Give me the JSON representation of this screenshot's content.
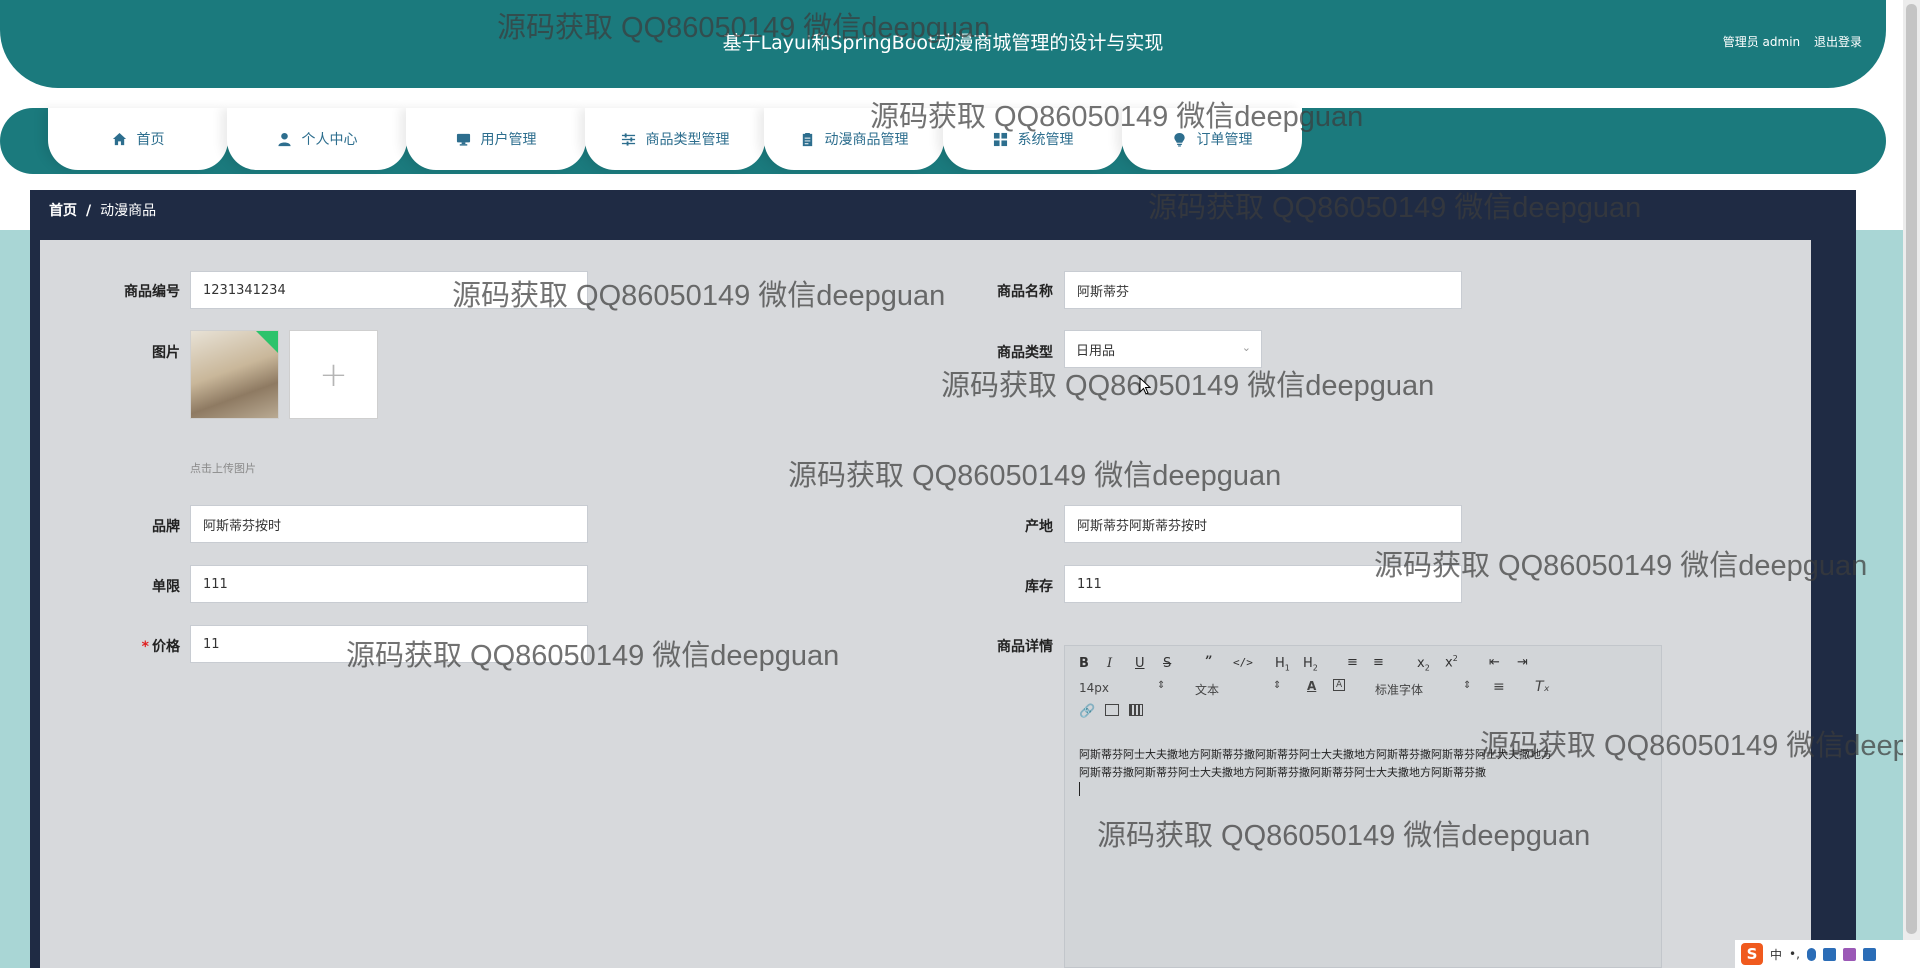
{
  "header": {
    "title": "基于Layui和SpringBoot动漫商城管理的设计与实现",
    "user_label": "管理员 admin",
    "logout_label": "退出登录"
  },
  "nav": {
    "items": [
      {
        "label": "首页",
        "icon": "home-icon"
      },
      {
        "label": "个人中心",
        "icon": "user-icon"
      },
      {
        "label": "用户管理",
        "icon": "monitor-icon"
      },
      {
        "label": "商品类型管理",
        "icon": "sliders-icon"
      },
      {
        "label": "动漫商品管理",
        "icon": "clipboard-icon"
      },
      {
        "label": "系统管理",
        "icon": "grid-icon"
      },
      {
        "label": "订单管理",
        "icon": "lightbulb-icon"
      }
    ]
  },
  "breadcrumb": {
    "home": "首页",
    "separator": "/",
    "current": "动漫商品"
  },
  "form": {
    "code_label": "商品编号",
    "code_value": "1231341234",
    "name_label": "商品名称",
    "name_value": "阿斯蒂芬",
    "image_label": "图片",
    "upload_hint": "点击上传图片",
    "type_label": "商品类型",
    "type_value": "日用品",
    "brand_label": "品牌",
    "brand_value": "阿斯蒂芬按时",
    "origin_label": "产地",
    "origin_value": "阿斯蒂芬阿斯蒂芬按时",
    "limit_label": "单限",
    "limit_value": "111",
    "stock_label": "库存",
    "stock_value": "111",
    "price_required_mark": "*",
    "price_label": "价格",
    "price_value": "11",
    "detail_label": "商品详情"
  },
  "editor": {
    "font_size": "14px",
    "text_type": "文本",
    "font_family": "标准字体",
    "content_line1": "阿斯蒂芬阿士大夫撒地方阿斯蒂芬撒阿斯蒂芬阿士大夫撒地方阿斯蒂芬撒阿斯蒂芬阿士大夫撒地方",
    "content_line2": "阿斯蒂芬撒阿斯蒂芬阿士大夫撒地方阿斯蒂芬撒阿斯蒂芬阿士大夫撒地方阿斯蒂芬撒"
  },
  "watermark": "源码获取 QQ86050149 微信deepguan",
  "ime": {
    "logo": "S",
    "lang": "中",
    "punct": "•,"
  }
}
